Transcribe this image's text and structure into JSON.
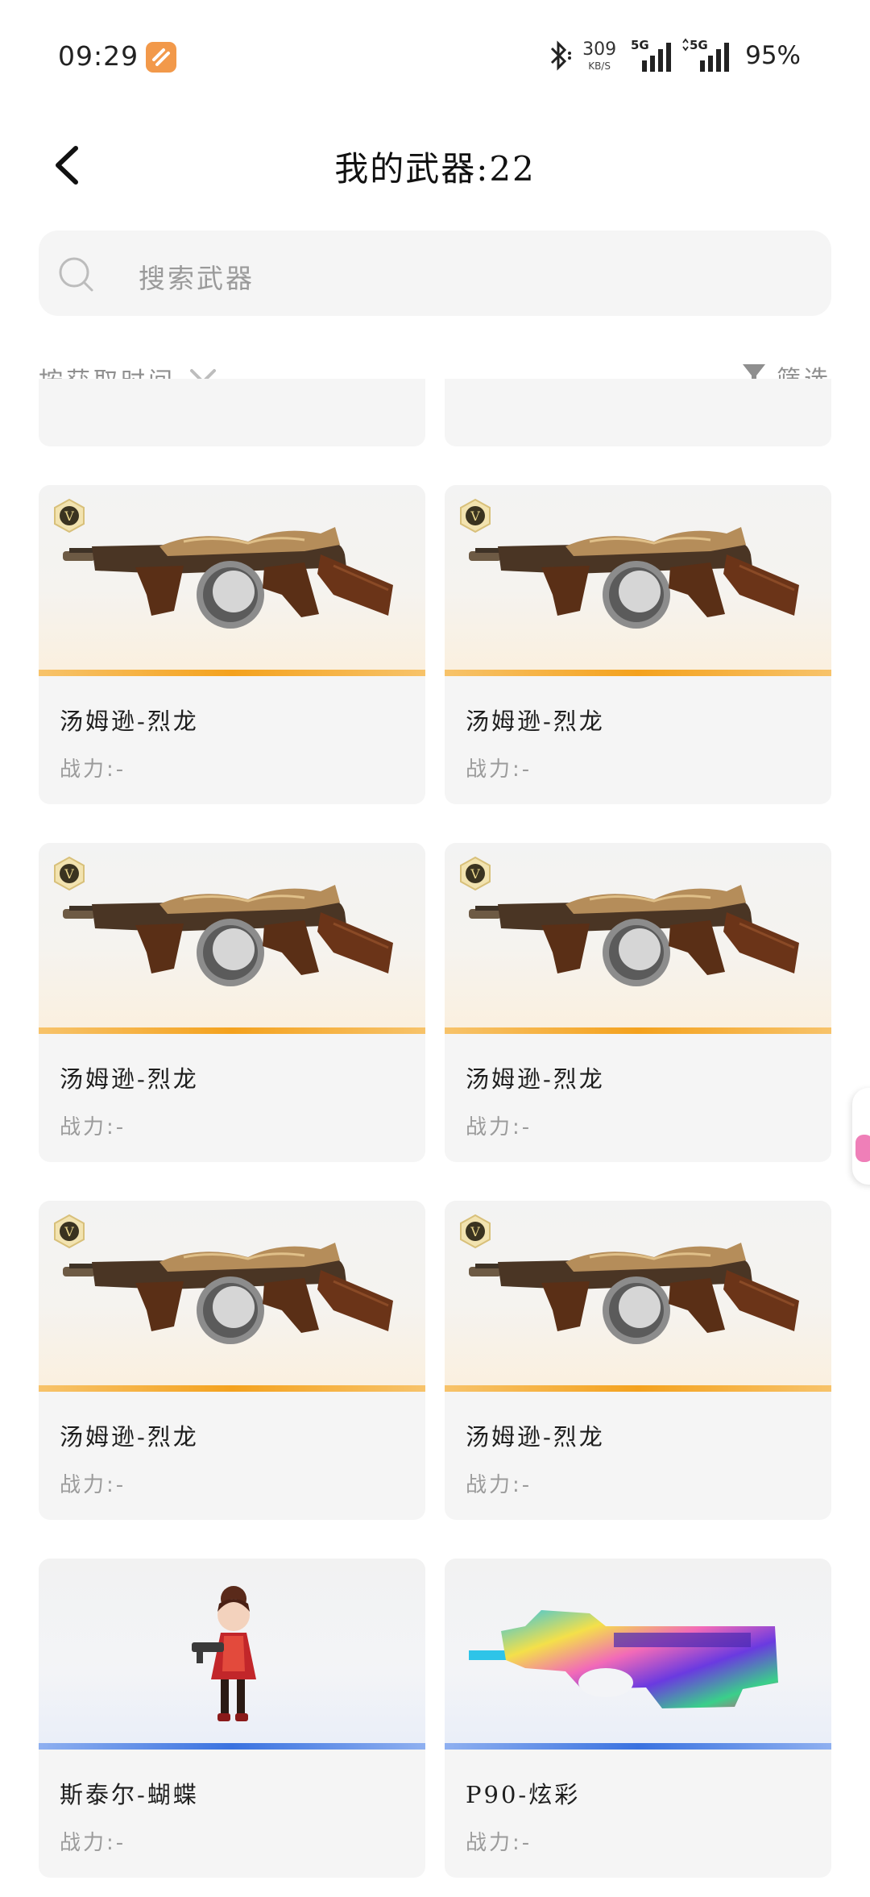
{
  "status_bar": {
    "time": "09:29",
    "net_speed_value": "309",
    "net_speed_unit": "KB/S",
    "sim1": "5G",
    "sim2": "5G",
    "battery": "95%"
  },
  "header": {
    "title": "我的武器:22"
  },
  "search": {
    "placeholder": "搜索武器"
  },
  "toolbar": {
    "sort_label": "按获取时间",
    "filter_label": "筛选"
  },
  "weapons": [
    {
      "name": "汤姆逊-烈龙",
      "power": "战力:-",
      "tier": "V",
      "rarity": "gold",
      "icon": "tommy-gun-dragon-icon"
    },
    {
      "name": "汤姆逊-烈龙",
      "power": "战力:-",
      "tier": "V",
      "rarity": "gold",
      "icon": "tommy-gun-dragon-icon"
    },
    {
      "name": "汤姆逊-烈龙",
      "power": "战力:-",
      "tier": "V",
      "rarity": "gold",
      "icon": "tommy-gun-dragon-icon"
    },
    {
      "name": "汤姆逊-烈龙",
      "power": "战力:-",
      "tier": "V",
      "rarity": "gold",
      "icon": "tommy-gun-dragon-icon"
    },
    {
      "name": "汤姆逊-烈龙",
      "power": "战力:-",
      "tier": "V",
      "rarity": "gold",
      "icon": "tommy-gun-dragon-icon"
    },
    {
      "name": "汤姆逊-烈龙",
      "power": "战力:-",
      "tier": "V",
      "rarity": "gold",
      "icon": "tommy-gun-dragon-icon"
    },
    {
      "name": "斯泰尔-蝴蝶",
      "power": "战力:-",
      "tier": "",
      "rarity": "blue",
      "icon": "character-with-smg-icon"
    },
    {
      "name": "P90-炫彩",
      "power": "战力:-",
      "tier": "",
      "rarity": "blue",
      "icon": "p90-rainbow-icon"
    }
  ],
  "colors": {
    "gold_stripe": "#f4a21e",
    "blue_stripe": "#3a72e0",
    "card_bg": "#f5f5f5",
    "muted_text": "#8f8f8f"
  }
}
